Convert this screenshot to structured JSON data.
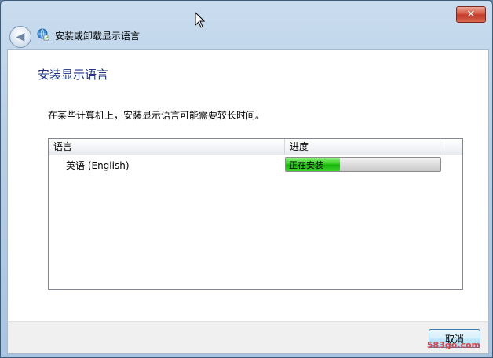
{
  "window": {
    "title": "安装或卸载显示语言",
    "close_label": "✕"
  },
  "page": {
    "heading": "安装显示语言",
    "description": "在某些计算机上，安装显示语言可能需要较长时间。"
  },
  "table": {
    "columns": [
      "语言",
      "进度"
    ],
    "rows": [
      {
        "language": "英语 (English)",
        "status": "正在安装",
        "progress": 0.35
      }
    ]
  },
  "footer": {
    "cancel_label": "取消",
    "watermark": "583go.com"
  },
  "colors": {
    "heading": "#1e3287",
    "progress_fill": "#2fd01d",
    "close": "#c0392b"
  }
}
